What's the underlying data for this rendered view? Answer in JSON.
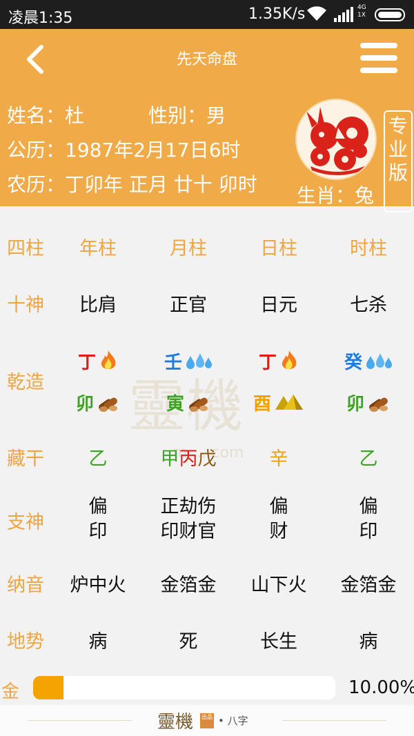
{
  "status_bar": {
    "time": "凌晨1:35",
    "speed": "1.35K/s",
    "network": "4G",
    "network_sub": "1X"
  },
  "header": {
    "title": "先天命盘",
    "name_line": "姓名：杜",
    "gender_line": "性别：男",
    "solar_line": "公历：1987年2月17日6时",
    "lunar_line": "农历：丁卯年 正月 廿十 卯时",
    "zodiac_label": "生肖：兔",
    "pro_badge": [
      "专",
      "业",
      "版"
    ]
  },
  "watermark": {
    "brand": "靈機",
    "url": "m.....com"
  },
  "chart": {
    "headers": {
      "label": "四柱",
      "cols": [
        "年柱",
        "月柱",
        "日柱",
        "时柱"
      ]
    },
    "ten_gods": {
      "label": "十神",
      "cols": [
        "比肩",
        "正官",
        "日元",
        "七杀"
      ]
    },
    "qianzao": {
      "label": "乾造",
      "stems": [
        {
          "char": "丁",
          "color": "#e31a1a",
          "icon": "fire-icon"
        },
        {
          "char": "壬",
          "color": "#1e7be0",
          "icon": "water-icon"
        },
        {
          "char": "丁",
          "color": "#e31a1a",
          "icon": "fire-icon"
        },
        {
          "char": "癸",
          "color": "#1e7be0",
          "icon": "water-icon"
        }
      ],
      "branches": [
        {
          "char": "卯",
          "color": "#3aa520",
          "icon": "wood-icon"
        },
        {
          "char": "寅",
          "color": "#3aa520",
          "icon": "wood-icon"
        },
        {
          "char": "酉",
          "color": "#f0a000",
          "icon": "metal-icon"
        },
        {
          "char": "卯",
          "color": "#3aa520",
          "icon": "wood-icon"
        }
      ]
    },
    "hidden_stems": {
      "label": "藏干",
      "cols": [
        [
          {
            "char": "乙",
            "color": "#3aa520"
          }
        ],
        [
          {
            "char": "甲",
            "color": "#3aa520"
          },
          {
            "char": "丙",
            "color": "#e31a1a"
          },
          {
            "char": "戊",
            "color": "#8b5a14"
          }
        ],
        [
          {
            "char": "辛",
            "color": "#f0a000"
          }
        ],
        [
          {
            "char": "乙",
            "color": "#3aa520"
          }
        ]
      ]
    },
    "branch_gods": {
      "label": "支神",
      "cols": [
        [
          "偏",
          "印"
        ],
        [
          "正劫伤",
          "印财官"
        ],
        [
          "偏",
          "财"
        ],
        [
          "偏",
          "印"
        ]
      ]
    },
    "nayin": {
      "label": "纳音",
      "cols": [
        "炉中火",
        "金箔金",
        "山下火",
        "金箔金"
      ]
    },
    "dishi": {
      "label": "地势",
      "cols": [
        "病",
        "死",
        "长生",
        "病"
      ]
    }
  },
  "element_bar": {
    "label": "金",
    "percent_text": "10.00%",
    "fraction": 0.1,
    "color": "#f5a300"
  },
  "footer": {
    "brand": "靈機",
    "seal": "出品",
    "sub": "• 八字"
  }
}
